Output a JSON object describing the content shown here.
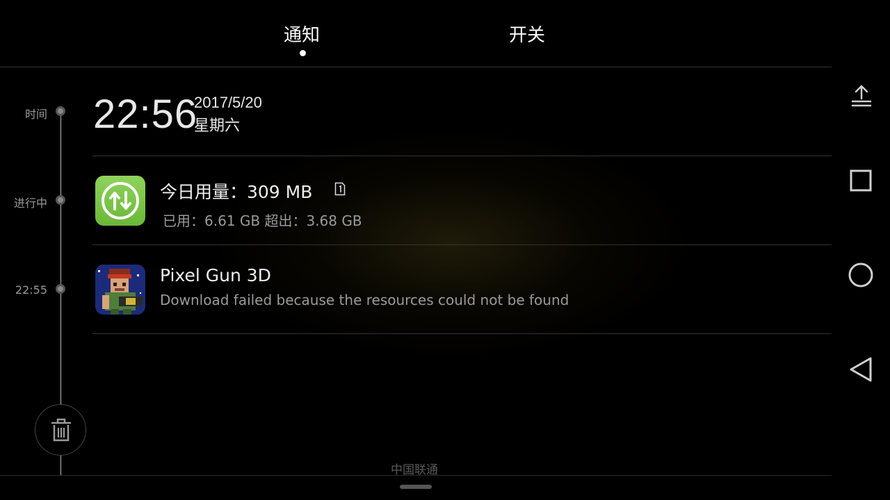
{
  "tabs": [
    {
      "label": "通知",
      "active": true
    },
    {
      "label": "开关",
      "active": false
    }
  ],
  "timeline": {
    "labels": [
      "时间",
      "进行中",
      "22:55"
    ]
  },
  "clock": {
    "time": "22:56",
    "date": "2017/5/20",
    "weekday": "星期六"
  },
  "notifications": [
    {
      "app_icon": "data-transfer-icon",
      "title": "今日用量：309 MB",
      "subtitle": "已用：6.61 GB 超出：3.68 GB",
      "badge_icon": "sim-card-1-icon"
    },
    {
      "app_icon": "pixel-gun-3d-app-icon",
      "title": "Pixel Gun 3D",
      "subtitle": "Download failed because the resources could not be found"
    }
  ],
  "footer": {
    "carrier": "中国联通",
    "clear_icon": "trash-icon"
  },
  "navbar": {
    "buttons": [
      "expand-up-icon",
      "recents-square-icon",
      "home-circle-icon",
      "back-triangle-icon"
    ]
  },
  "colors": {
    "background": "#000000",
    "data_icon_green": "#7cc54a",
    "secondary_text": "#9a9a9a"
  }
}
